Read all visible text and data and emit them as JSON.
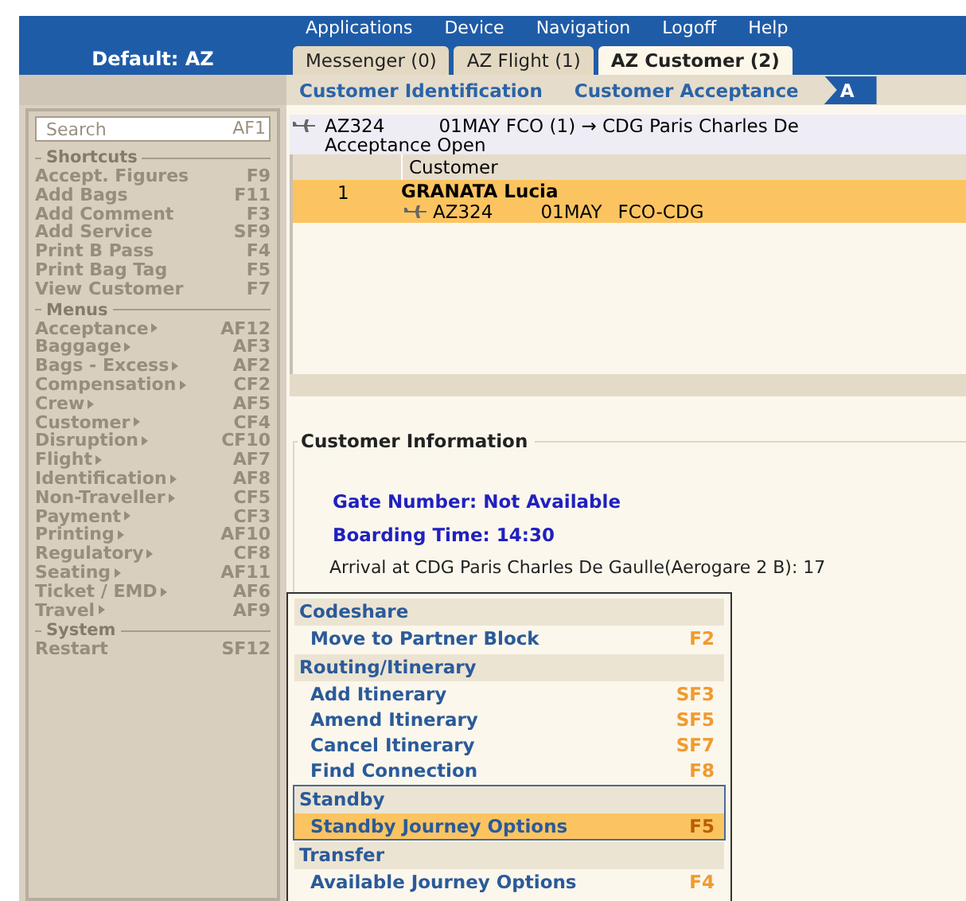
{
  "brand": "Default: AZ",
  "menu_bar": [
    "Applications",
    "Device",
    "Navigation",
    "Logoff",
    "Help"
  ],
  "tabs": [
    {
      "label": "Messenger (0)",
      "selected": false
    },
    {
      "label": "AZ Flight (1)",
      "selected": false
    },
    {
      "label": "AZ Customer (2)",
      "selected": true
    }
  ],
  "breadcrumbs": [
    {
      "label": "Customer Identification",
      "selected": false
    },
    {
      "label": "Customer Acceptance",
      "selected": false
    },
    {
      "label": "A",
      "selected": true
    }
  ],
  "sidebar": {
    "search": {
      "placeholder": "Search",
      "key": "AF1"
    },
    "sections": [
      {
        "title": "Shortcuts",
        "items": [
          {
            "label": "Accept. Figures",
            "key": "F9",
            "kind": "action"
          },
          {
            "label": "Add Bags",
            "key": "F11",
            "kind": "action"
          },
          {
            "label": "Add Comment",
            "key": "F3",
            "kind": "action"
          },
          {
            "label": "Add Service",
            "key": "SF9",
            "kind": "action"
          },
          {
            "label": "Print B Pass",
            "key": "F4",
            "kind": "action"
          },
          {
            "label": "Print Bag Tag",
            "key": "F5",
            "kind": "action"
          },
          {
            "label": "View Customer",
            "key": "F7",
            "kind": "action"
          }
        ]
      },
      {
        "title": "Menus",
        "items": [
          {
            "label": "Acceptance",
            "key": "AF12",
            "kind": "submenu"
          },
          {
            "label": "Baggage",
            "key": "AF3",
            "kind": "submenu"
          },
          {
            "label": "Bags - Excess",
            "key": "AF2",
            "kind": "submenu"
          },
          {
            "label": "Compensation",
            "key": "CF2",
            "kind": "submenu"
          },
          {
            "label": "Crew",
            "key": "AF5",
            "kind": "submenu"
          },
          {
            "label": "Customer",
            "key": "CF4",
            "kind": "submenu"
          },
          {
            "label": "Disruption",
            "key": "CF10",
            "kind": "submenu"
          },
          {
            "label": "Flight",
            "key": "AF7",
            "kind": "submenu"
          },
          {
            "label": "Identification",
            "key": "AF8",
            "kind": "submenu"
          },
          {
            "label": "Non-Traveller",
            "key": "CF5",
            "kind": "submenu"
          },
          {
            "label": "Payment",
            "key": "CF3",
            "kind": "submenu"
          },
          {
            "label": "Printing",
            "key": "AF10",
            "kind": "submenu"
          },
          {
            "label": "Regulatory",
            "key": "CF8",
            "kind": "submenu"
          },
          {
            "label": "Seating",
            "key": "AF11",
            "kind": "submenu"
          },
          {
            "label": "Ticket / EMD",
            "key": "AF6",
            "kind": "submenu"
          },
          {
            "label": "Travel",
            "key": "AF9",
            "kind": "submenu"
          }
        ]
      },
      {
        "title": "System",
        "items": [
          {
            "label": "Restart",
            "key": "SF12",
            "kind": "action"
          }
        ]
      }
    ]
  },
  "flight": {
    "number": "AZ324",
    "route": "01MAY FCO (1) → CDG Paris Charles De",
    "status": "Acceptance Open"
  },
  "table": {
    "columns": [
      "Customer"
    ],
    "rows": [
      {
        "index": "1",
        "name": "GRANATA Lucia",
        "flight": "AZ324",
        "date": "01MAY",
        "route": "FCO-CDG",
        "selected": true
      }
    ]
  },
  "customer_info": {
    "title": "Customer Information",
    "highlights": [
      "Gate Number: Not Available",
      "Boarding Time: 14:30"
    ],
    "arrival": "Arrival at CDG Paris Charles De Gaulle(Aerogare 2 B): 17"
  },
  "popup_menu": [
    {
      "title": "Codeshare",
      "items": [
        {
          "label": "Move to Partner Block",
          "key": "F2",
          "selected": false
        }
      ]
    },
    {
      "title": "Routing/Itinerary",
      "items": [
        {
          "label": "Add Itinerary",
          "key": "SF3",
          "selected": false
        },
        {
          "label": "Amend Itinerary",
          "key": "SF5",
          "selected": false
        },
        {
          "label": "Cancel Itinerary",
          "key": "SF7",
          "selected": false
        },
        {
          "label": "Find Connection",
          "key": "F8",
          "selected": false
        }
      ]
    },
    {
      "title": "Standby",
      "items": [
        {
          "label": "Standby Journey Options",
          "key": "F5",
          "selected": true
        }
      ]
    },
    {
      "title": "Transfer",
      "items": [
        {
          "label": "Available Journey Options",
          "key": "F4",
          "selected": false
        }
      ]
    }
  ]
}
